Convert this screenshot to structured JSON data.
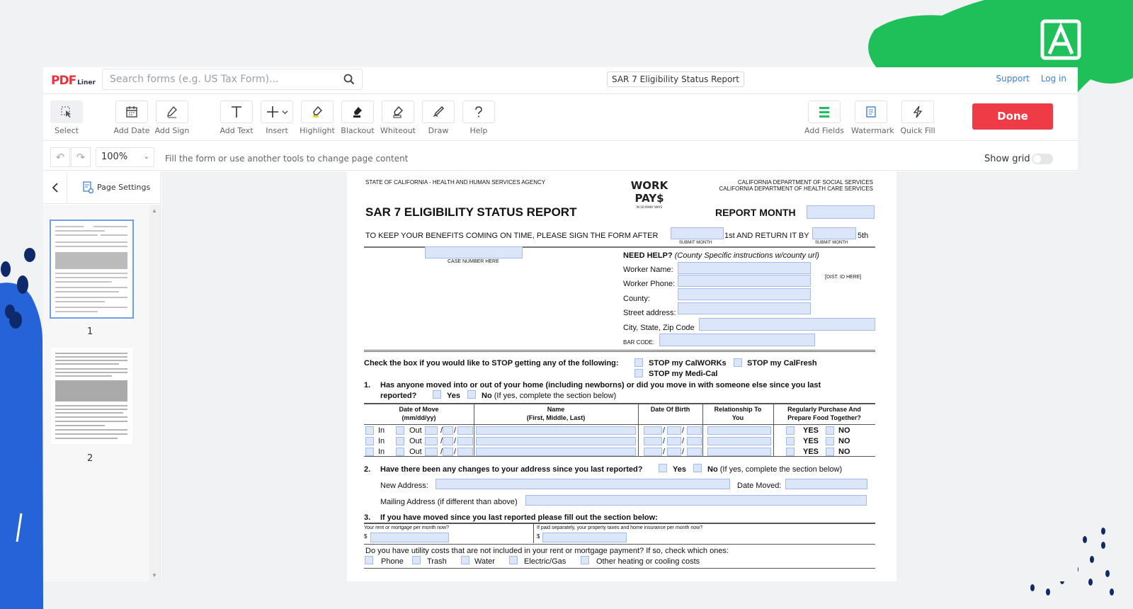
{
  "header": {
    "search_placeholder": "Search forms (e.g. US Tax Form)...",
    "doc_title": "SAR 7 Eligibility Status Report",
    "support": "Support",
    "login": "Log in"
  },
  "toolbar": {
    "select": "Select",
    "add_date": "Add Date",
    "add_sign": "Add Sign",
    "add_text": "Add Text",
    "insert": "Insert",
    "highlight": "Highlight",
    "blackout": "Blackout",
    "whiteout": "Whiteout",
    "draw": "Draw",
    "help": "Help",
    "add_fields": "Add Fields",
    "watermark": "Watermark",
    "quick_fill": "Quick Fill",
    "done": "Done"
  },
  "subbar": {
    "zoom": "100%",
    "hint": "Fill the form or use another tools to change page content",
    "show_grid": "Show grid"
  },
  "sidebar": {
    "page_settings": "Page Settings",
    "pages": [
      "1",
      "2"
    ]
  },
  "form": {
    "agency": "STATE OF CALIFORNIA - HEALTH AND HUMAN SERVICES AGENCY",
    "dept1": "CALIFORNIA DEPARTMENT OF SOCIAL SERVICES",
    "dept2": "CALIFORNIA DEPARTMENT OF HEALTH CARE SERVICES",
    "title": "SAR 7 ELIGIBILITY STATUS REPORT",
    "report_month": "REPORT MONTH",
    "keep_benefits": "TO KEEP YOUR BENEFITS COMING ON TIME, PLEASE SIGN THE FORM AFTER",
    "first_return": "1st AND RETURN IT BY",
    "fifth": "5th",
    "submit_month": "SUBMIT MONTH",
    "case_number": "CASE NUMBER HERE",
    "need_help": "NEED HELP?",
    "county_instr": "(County Specific instructions w/county url)",
    "worker_name": "Worker Name:",
    "worker_phone": "Worker Phone:",
    "county": "County:",
    "street": "Street address:",
    "city": "City, State, Zip Code",
    "bar_code": "BAR CODE:",
    "dist_id": "[DIST. ID HERE]",
    "stop_q": "Check the box if you would like to STOP getting any of the following:",
    "stop_calworks": "STOP my CalWORKs",
    "stop_calfresh": "STOP my CalFresh",
    "stop_medical": "STOP my Medi-Cal",
    "q1_num": "1.",
    "q1_a": "Has anyone moved into or out of your home (including newborns) or did you move in with someone else since you last",
    "q1_b": "reported?",
    "yes": "Yes",
    "no": "No",
    "complete_note": "(If yes, complete the section below)",
    "col_date_move": "Date of Move",
    "col_date_move2": "(mm/dd/yy)",
    "col_name": "Name",
    "col_name2": "(First, Middle, Last)",
    "col_dob": "Date Of Birth",
    "col_rel": "Relationship To",
    "col_rel2": "You",
    "col_food": "Regularly Purchase And",
    "col_food2": "Prepare Food Together?",
    "in": "In",
    "out": "Out",
    "slash": "/",
    "yes_cap": "YES",
    "no_cap": "NO",
    "q2_num": "2.",
    "q2": "Have there been any changes to your address since you last reported?",
    "new_address": "New Address:",
    "date_moved": "Date Moved:",
    "mailing": "Mailing Address (if different than above)",
    "q3_num": "3.",
    "q3": "If you have moved since you last reported please fill out the section below:",
    "rent": "Your rent or mortgage per month now?",
    "taxes": "If paid separately, your property taxes and home insurance per month now?",
    "dollar": "$",
    "utility": "Do you have utility costs that are not included in your rent or mortgage payment?  If so, check which ones:",
    "phone": "Phone",
    "trash": "Trash",
    "water": "Water",
    "electric": "Electric/Gas",
    "heating": "Other heating or cooling costs",
    "logo_top": "WORK",
    "logo_bottom": "PAY$",
    "logo_tag": "IN SO MANY WAYS"
  },
  "colors": {
    "accent_red": "#ef3b46",
    "link_blue": "#3f7fd9",
    "field_fill": "#dbe6fb",
    "deco_green": "#1fbf5a",
    "deco_blue": "#2563d9"
  }
}
